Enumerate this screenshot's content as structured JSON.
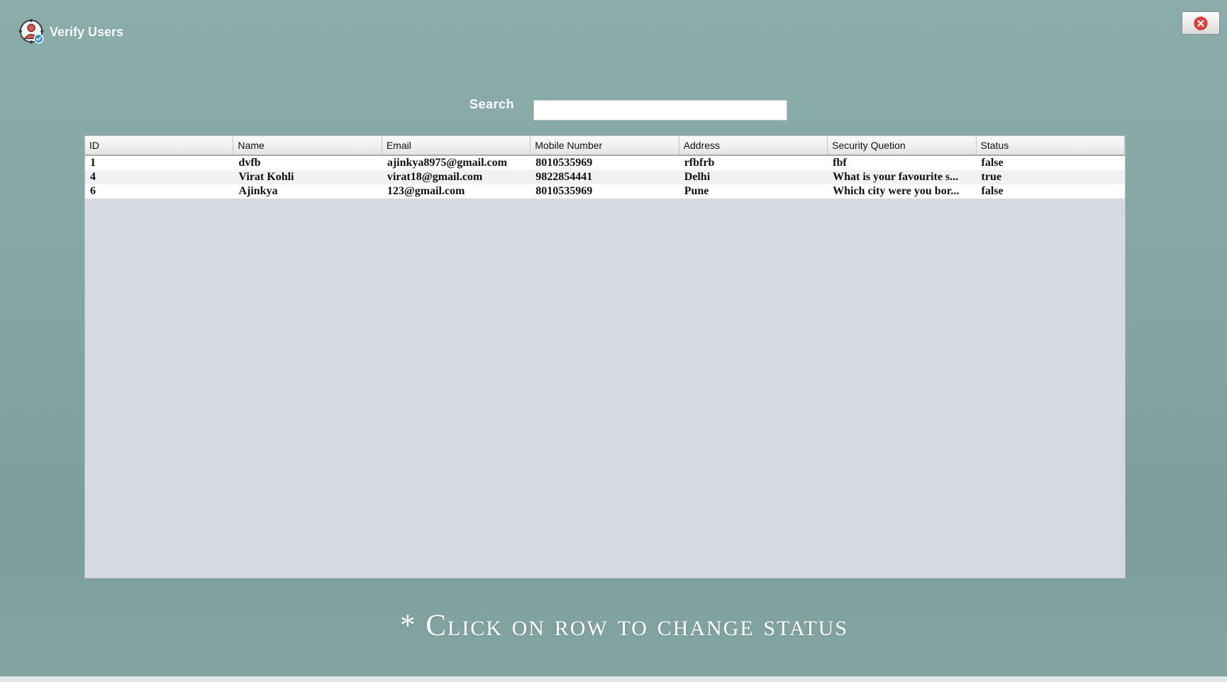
{
  "app": {
    "title": "Verify Users",
    "logo_icon": "verified-user-icon"
  },
  "window": {
    "close_icon": "close-icon",
    "close_color": "#e8413a"
  },
  "search": {
    "label": "Search",
    "value": "",
    "placeholder": ""
  },
  "table": {
    "columns": [
      "ID",
      "Name",
      "Email",
      "Mobile Number",
      "Address",
      "Security Quetion",
      "Status"
    ],
    "rows": [
      [
        "1",
        "dvfb",
        "ajinkya8975@gmail.com",
        "8010535969",
        "rfbfrb",
        "fbf",
        "false"
      ],
      [
        "4",
        "Virat Kohli",
        "virat18@gmail.com",
        "9822854441",
        "Delhi",
        "What is your favourite s...",
        "true"
      ],
      [
        "6",
        "Ajinkya",
        "123@gmail.com",
        "8010535969",
        "Pune",
        "Which city were you bor...",
        "false"
      ]
    ]
  },
  "hint": {
    "text": "* Click on row to change status"
  },
  "colors": {
    "background": "#86a8a5",
    "table_body": "#d6d9e2",
    "header_text": "#ffffff"
  }
}
